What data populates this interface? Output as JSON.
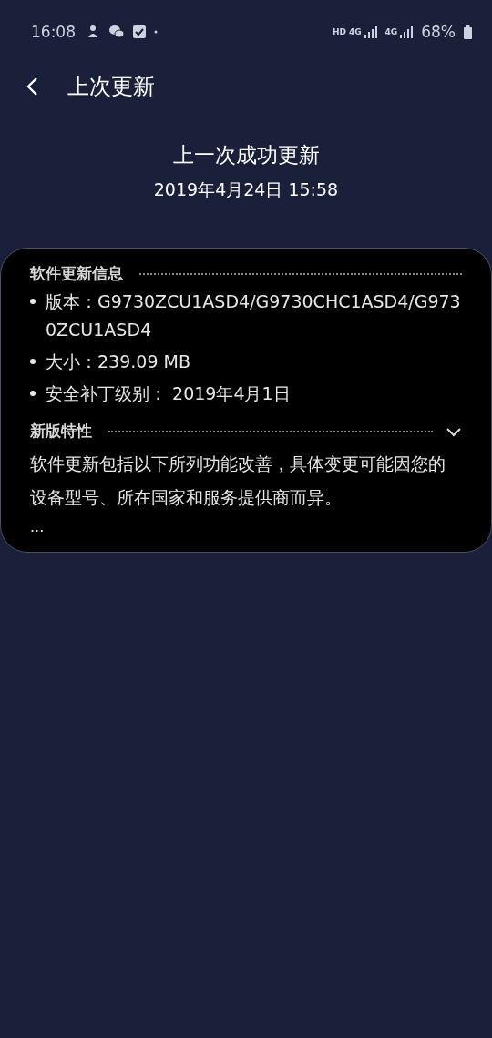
{
  "status_bar": {
    "time": "16:08",
    "network": [
      "HD",
      "4G",
      "4G"
    ],
    "battery": "68%"
  },
  "header": {
    "title": "上次更新"
  },
  "summary": {
    "title": "上一次成功更新",
    "date": "2019年4月24日 15:58"
  },
  "card": {
    "info_heading": "软件更新信息",
    "info_items": [
      "版本：G9730ZCU1ASD4/G9730CHC1ASD4/G9730ZCU1ASD4",
      "大小：239.09 MB",
      "安全补丁级别： 2019年4月1日"
    ],
    "features_heading": "新版特性",
    "features_expanded": false,
    "features_text": "软件更新包括以下所列功能改善，具体变更可能因您的设备型号、所在国家和服务提供商而异。",
    "more": "..."
  }
}
